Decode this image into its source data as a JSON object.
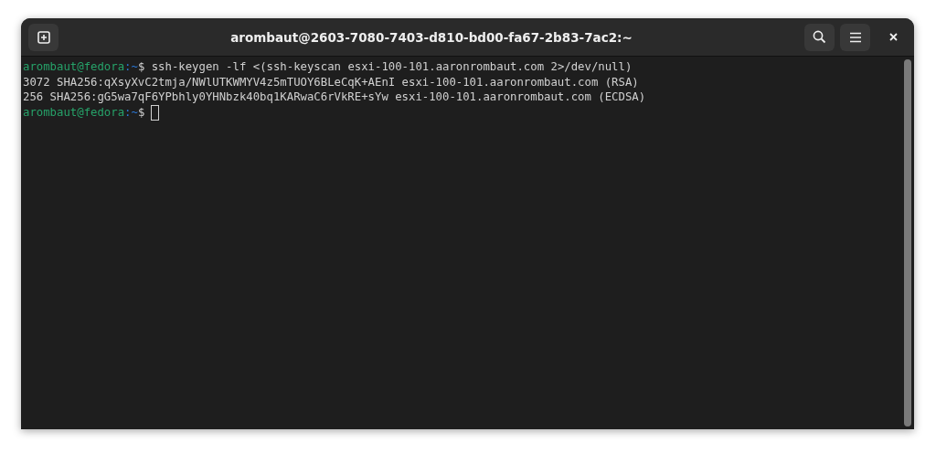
{
  "window": {
    "title": "arombaut@2603-7080-7403-d810-bd00-fa67-2b83-7ac2:~"
  },
  "terminal": {
    "lines": [
      {
        "kind": "prompt",
        "user_host": "arombaut@fedora",
        "path": ":~",
        "symbol": "$",
        "command": "ssh-keygen -lf <(ssh-keyscan esxi-100-101.aaronrombaut.com 2>/dev/null)",
        "cursor": false
      },
      {
        "kind": "output",
        "text": "3072 SHA256:qXsyXvC2tmja/NWlUTKWMYV4z5mTUOY6BLeCqK+AEnI esxi-100-101.aaronrombaut.com (RSA)"
      },
      {
        "kind": "output",
        "text": "256 SHA256:gG5wa7qF6YPbhly0YHNbzk40bq1KARwaC6rVkRE+sYw esxi-100-101.aaronrombaut.com (ECDSA)"
      },
      {
        "kind": "prompt",
        "user_host": "arombaut@fedora",
        "path": ":~",
        "symbol": "$",
        "cursor": true
      }
    ]
  }
}
